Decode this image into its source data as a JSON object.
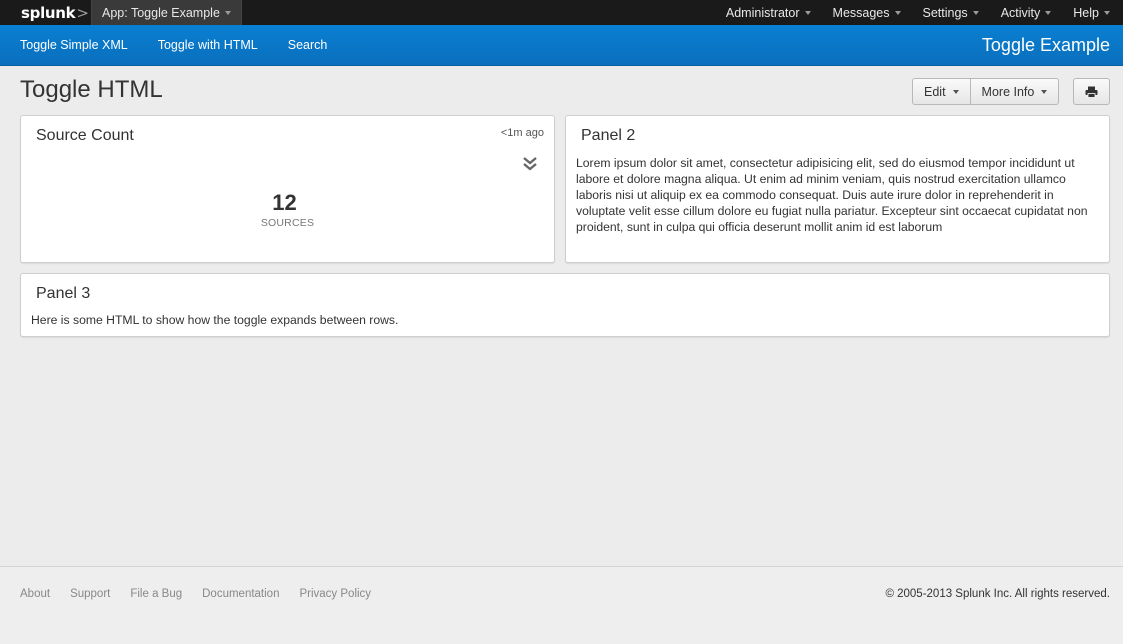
{
  "topbar": {
    "logo_text": "splunk",
    "logo_suffix": ">",
    "app_menu_label": "App: Toggle Example",
    "nav": [
      "Administrator",
      "Messages",
      "Settings",
      "Activity",
      "Help"
    ]
  },
  "appbar": {
    "links": [
      "Toggle Simple XML",
      "Toggle with HTML",
      "Search"
    ],
    "title": "Toggle Example"
  },
  "dashboard": {
    "title": "Toggle HTML",
    "edit_label": "Edit",
    "more_info_label": "More Info",
    "print_icon": "print-icon"
  },
  "panels": {
    "source_count": {
      "title": "Source Count",
      "timestamp": "<1m ago",
      "toggle_icon": "double-chevron-down-icon",
      "value": "12",
      "underlabel": "SOURCES"
    },
    "panel2": {
      "title": "Panel 2",
      "text": "Lorem ipsum dolor sit amet, consectetur adipisicing elit, sed do eiusmod tempor incididunt ut labore et dolore magna aliqua. Ut enim ad minim veniam, quis nostrud exercitation ullamco laboris nisi ut aliquip ex ea commodo consequat. Duis aute irure dolor in reprehenderit in voluptate velit esse cillum dolore eu fugiat nulla pariatur. Excepteur sint occaecat cupidatat non proident, sunt in culpa qui officia deserunt mollit anim id est laborum"
    },
    "panel3": {
      "title": "Panel 3",
      "text": "Here is some HTML to show how the toggle expands between rows."
    }
  },
  "footer": {
    "links": [
      "About",
      "Support",
      "File a Bug",
      "Documentation",
      "Privacy Policy"
    ],
    "copyright": "© 2005-2013 Splunk Inc. All rights reserved."
  },
  "colors": {
    "topbar": "#1a1a1a",
    "appbar": "#0a74c8",
    "page_bg": "#ececec"
  }
}
